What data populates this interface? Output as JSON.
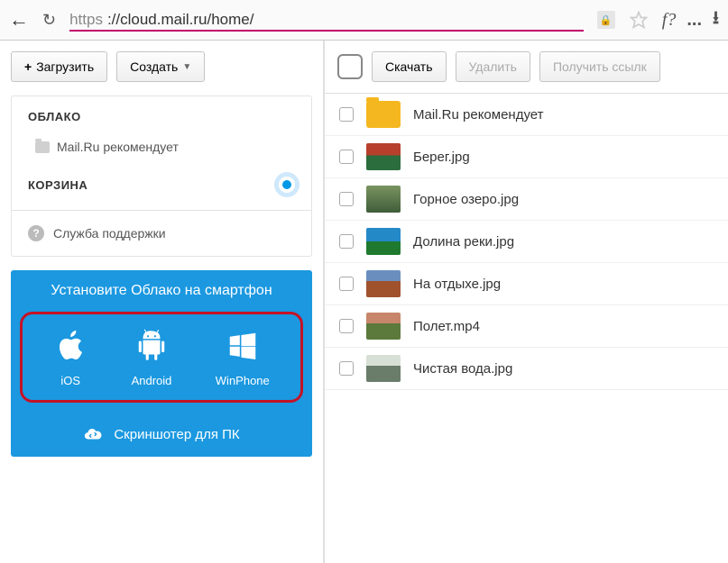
{
  "browser": {
    "url_proto": "https",
    "url_host": "://cloud.mail.ru/home/",
    "toolbar_f": "f?",
    "toolbar_more": "..."
  },
  "sidebar": {
    "upload_label": "Загрузить",
    "create_label": "Создать",
    "cloud_heading": "ОБЛАКО",
    "folder_label": "Mail.Ru рекомендует",
    "trash_heading": "КОРЗИНА",
    "support_label": "Служба поддержки"
  },
  "promo": {
    "title": "Установите Облако на смартфон",
    "platforms": [
      {
        "label": "iOS"
      },
      {
        "label": "Android"
      },
      {
        "label": "WinPhone"
      }
    ],
    "screenshooter_label": "Скриншотер для ПК"
  },
  "actions": {
    "download": "Скачать",
    "delete": "Удалить",
    "get_link": "Получить ссылк"
  },
  "files": [
    {
      "name": "Mail.Ru рекомендует",
      "type": "folder"
    },
    {
      "name": "Берег.jpg",
      "thumb": "t1"
    },
    {
      "name": "Горное озеро.jpg",
      "thumb": "t2"
    },
    {
      "name": "Долина реки.jpg",
      "thumb": "t3"
    },
    {
      "name": "На отдыхе.jpg",
      "thumb": "t4"
    },
    {
      "name": "Полет.mp4",
      "thumb": "t5"
    },
    {
      "name": "Чистая вода.jpg",
      "thumb": "t6"
    }
  ]
}
